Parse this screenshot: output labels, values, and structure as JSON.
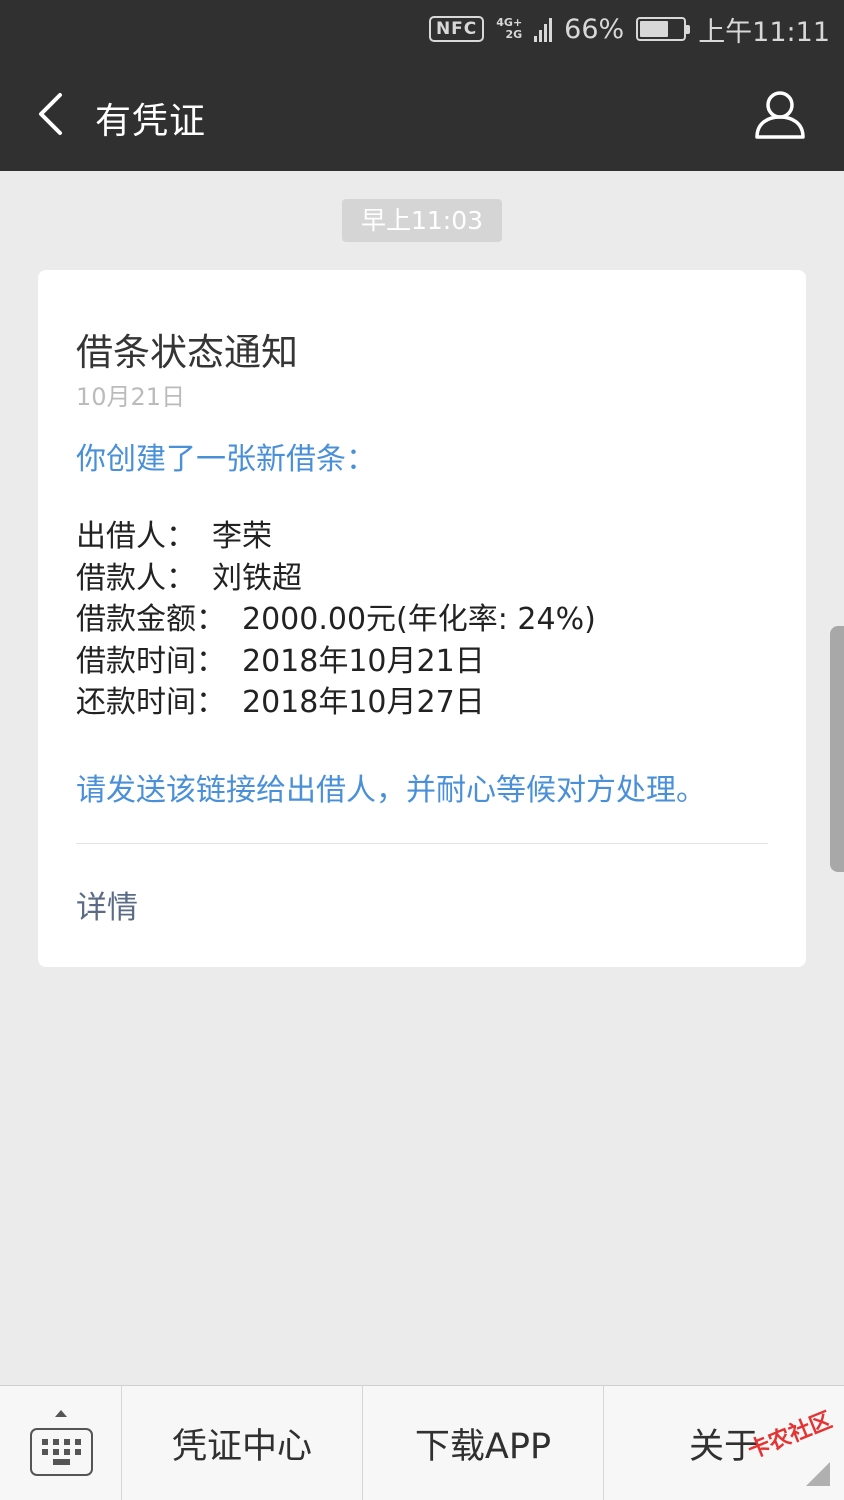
{
  "status_bar": {
    "nfc": "NFC",
    "network_top": "4G+",
    "network_bottom": "2G",
    "battery": "66%",
    "battery_level": 0.66,
    "time": "上午11:11"
  },
  "header": {
    "back_icon": "chevron-left-icon",
    "title": "有凭证",
    "profile_icon": "user-icon"
  },
  "chat": {
    "timestamp": "早上11:03"
  },
  "message": {
    "title": "借条状态通知",
    "date": "10月21日",
    "intro": "你创建了一张新借条：",
    "fields": [
      {
        "label": "出借人：",
        "value": "李荣"
      },
      {
        "label": "借款人：",
        "value": "刘铁超"
      },
      {
        "label": "借款金额：",
        "value": "2000.00元(年化率: 24%)"
      },
      {
        "label": "借款时间：",
        "value": "2018年10月21日"
      },
      {
        "label": "还款时间：",
        "value": "2018年10月27日"
      }
    ],
    "note": "请发送该链接给出借人，并耐心等候对方处理。",
    "detail_link": "详情"
  },
  "bottom_menu": {
    "keyboard_icon": "keyboard-icon",
    "tabs": [
      "凭证中心",
      "下载APP",
      "关于"
    ]
  },
  "watermark": "卡农社区",
  "colors": {
    "bar_bg": "#303030",
    "page_bg": "#ebebeb",
    "link_blue": "#4a90d9",
    "detail_link": "#5b6b85"
  }
}
